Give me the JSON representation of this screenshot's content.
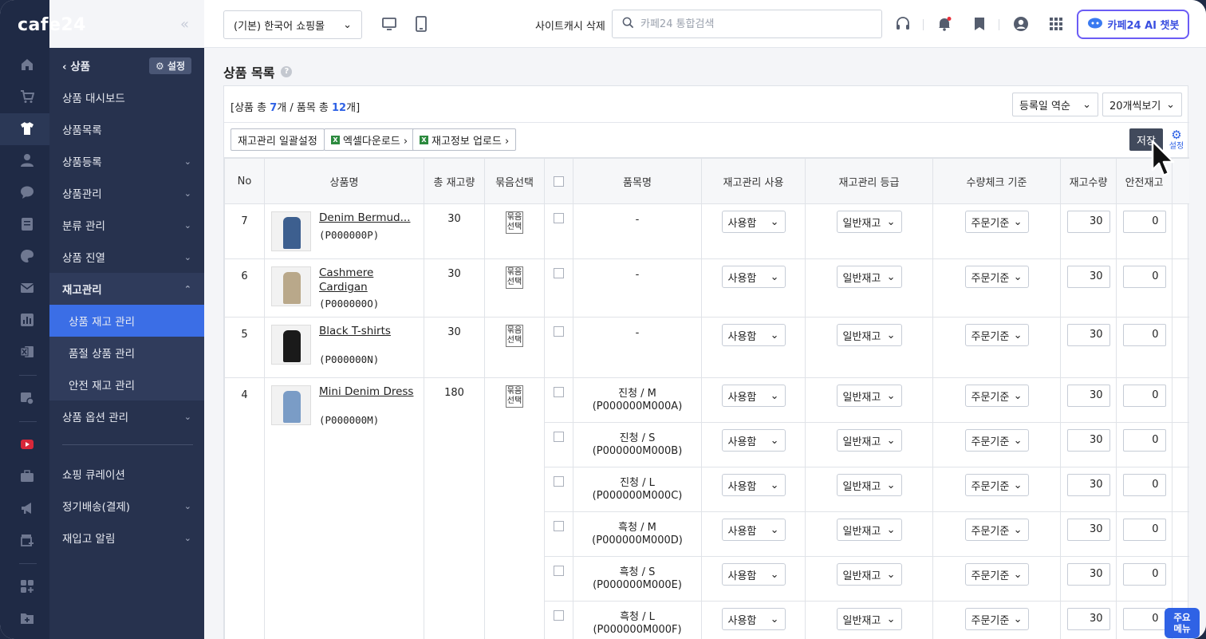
{
  "app": {
    "logo": "cafe24",
    "collapse_icon": "«"
  },
  "rail_icons": [
    "home-icon",
    "cart-icon",
    "shirt-icon",
    "user-icon",
    "chat-icon",
    "board-icon",
    "palette-icon",
    "mail-icon",
    "chart-icon",
    "excel-icon",
    "gear-badge-icon",
    "youtube-icon",
    "briefcase-icon",
    "megaphone-icon",
    "store-plus-icon",
    "apps-plus-icon",
    "folder-plus-icon"
  ],
  "submenu": {
    "back_label": "상품",
    "settings_label": "설정",
    "items": [
      {
        "label": "상품 대시보드"
      },
      {
        "label": "상품목록"
      },
      {
        "label": "상품등록",
        "chevron": "⌄"
      },
      {
        "label": "상품관리",
        "chevron": "⌄"
      },
      {
        "label": "분류 관리",
        "chevron": "⌄"
      },
      {
        "label": "상품 진열",
        "chevron": "⌄"
      },
      {
        "label": "재고관리",
        "chevron": "⌃"
      },
      {
        "label": "상품 재고 관리"
      },
      {
        "label": "품절 상품 관리"
      },
      {
        "label": "안전 재고 관리"
      },
      {
        "label": "상품 옵션 관리",
        "chevron": "⌄"
      },
      {
        "label": "쇼핑 큐레이션"
      },
      {
        "label": "정기배송(결제)",
        "chevron": "⌄"
      },
      {
        "label": "재입고 알림",
        "chevron": "⌄"
      }
    ]
  },
  "topbar": {
    "mall_select": "(기본) 한국어 쇼핑몰",
    "cache_delete": "사이트캐시 삭제",
    "search_placeholder": "카페24 통합검색",
    "chatbot_label": "카페24 AI 챗봇"
  },
  "page": {
    "title": "상품 목록"
  },
  "summary": {
    "prefix": "[상품 총 ",
    "product_count": "7",
    "mid": "개 / 품목 총 ",
    "item_count": "12",
    "suffix": "개]"
  },
  "sort_select": "등록일 역순",
  "page_size_select": "20개씩보기",
  "toolbar": {
    "bulk_settings": "재고관리 일괄설정",
    "excel_download": "엑셀다운로드 ›",
    "stock_upload": "재고정보 업로드 ›",
    "save": "저장",
    "settings": "설정"
  },
  "table": {
    "headers": [
      "No",
      "상품명",
      "총 재고량",
      "묶음선택",
      "",
      "품목명",
      "재고관리 사용",
      "재고관리 등급",
      "수량체크 기준",
      "재고수량",
      "안전재고"
    ],
    "bundle_label_1": "묶음",
    "bundle_label_2": "선택",
    "use_value": "사용함",
    "grade_value": "일반재고",
    "check_value": "주문기준",
    "rows": [
      {
        "no": "7",
        "name": "Denim Bermud...",
        "code": "(P000000P)",
        "stock": "30",
        "options": [
          {
            "label": "-",
            "code": "",
            "qty": "30",
            "safe": "0"
          }
        ]
      },
      {
        "no": "6",
        "name": "Cashmere Cardigan",
        "code": "(P000000O)",
        "stock": "30",
        "options": [
          {
            "label": "-",
            "code": "",
            "qty": "30",
            "safe": "0"
          }
        ]
      },
      {
        "no": "5",
        "name": "Black T-shirts",
        "code": "(P000000N)",
        "stock": "30",
        "options": [
          {
            "label": "-",
            "code": "",
            "qty": "30",
            "safe": "0"
          }
        ]
      },
      {
        "no": "4",
        "name": "Mini Denim Dress",
        "code": "(P000000M)",
        "stock": "180",
        "options": [
          {
            "label": "진청 / M",
            "code": "(P000000M000A)",
            "qty": "30",
            "safe": "0"
          },
          {
            "label": "진청 / S",
            "code": "(P000000M000B)",
            "qty": "30",
            "safe": "0"
          },
          {
            "label": "진청 / L",
            "code": "(P000000M000C)",
            "qty": "30",
            "safe": "0"
          },
          {
            "label": "흑청 / M",
            "code": "(P000000M000D)",
            "qty": "30",
            "safe": "0"
          },
          {
            "label": "흑청 / S",
            "code": "(P000000M000E)",
            "qty": "30",
            "safe": "0"
          },
          {
            "label": "흑청 / L",
            "code": "(P000000M000F)",
            "qty": "30",
            "safe": "0"
          }
        ]
      }
    ]
  },
  "quick_menu": {
    "line1": "주요",
    "line2": "메뉴"
  },
  "colors": {
    "sidebar": "#1f2a45",
    "submenu": "#27324e",
    "active": "#3b6ee6",
    "accent": "#2f62e5",
    "chatbot_border": "#6b5cf5"
  }
}
